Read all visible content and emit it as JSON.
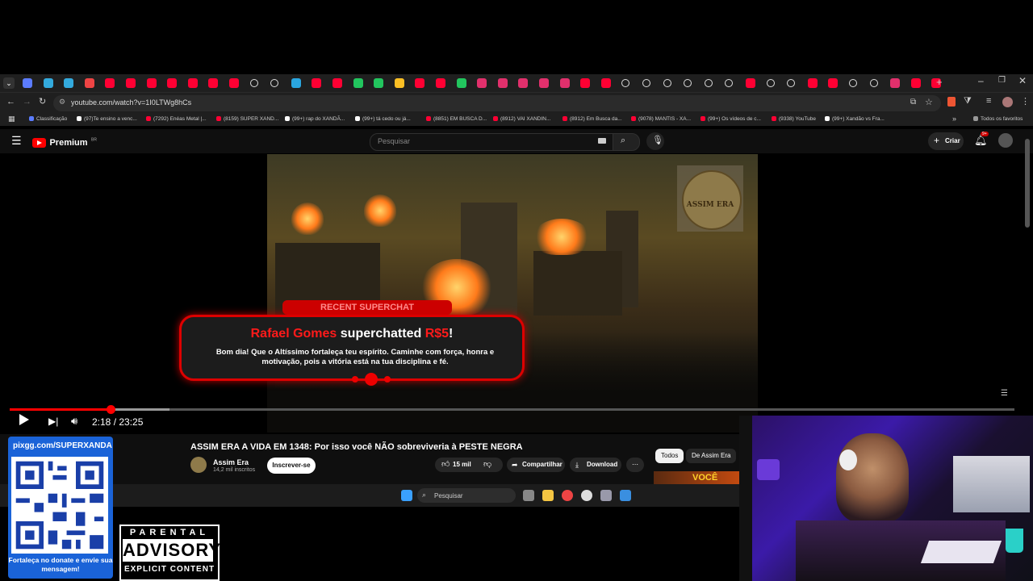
{
  "browser": {
    "url": "youtube.com/watch?v=1I0LTWg8hCs",
    "bookmarks": [
      {
        "label": "Classificação",
        "color": "#5b7cff"
      },
      {
        "label": "(97)Te ensino a venc...",
        "color": "#ffffff"
      },
      {
        "label": "(7292) Enéas Metal |...",
        "color": "#ff0033"
      },
      {
        "label": "(8159) SUPER XAND...",
        "color": "#ff0033"
      },
      {
        "label": "(99+) rap do XANDÃ...",
        "color": "#ffffff"
      },
      {
        "label": "(99+) tá cedo ou já...",
        "color": "#ffffff"
      },
      {
        "label": "(8851) EM BUSCA D...",
        "color": "#ff0033"
      },
      {
        "label": "(8912) VAI XANDIN...",
        "color": "#ff0033"
      },
      {
        "label": "(8912) Em Busca da...",
        "color": "#ff0033"
      },
      {
        "label": "(9078) MANTIS - XA...",
        "color": "#ff0033"
      },
      {
        "label": "(99+) Os vídeos de c...",
        "color": "#ff0033"
      },
      {
        "label": "(9338) YouTube",
        "color": "#ff0033"
      },
      {
        "label": "(99+) Xandão vs Fra...",
        "color": "#ffffff"
      }
    ],
    "all_bookmarks": "Todos os favoritos"
  },
  "youtube": {
    "logo_text": "Premium",
    "region": "BR",
    "search_placeholder": "Pesquisar",
    "create_label": "Criar",
    "notif_badge": "9+"
  },
  "video": {
    "watermark": "ASSIM ERA",
    "superchat_tag": "RECENT SUPERCHAT",
    "superchat_name": "Rafael Gomes",
    "superchat_verb": " superchatted ",
    "superchat_amount": "R$5",
    "superchat_bang": "!",
    "superchat_message": "Bom dia! Que o Altíssimo fortaleça teu espírito. Caminhe com força, honra e motivação, pois a vitória está na tua disciplina e fé.",
    "current_time": "2:18",
    "duration": "23:25",
    "progress": 0.1,
    "buffered": 0.159
  },
  "watch": {
    "title": "ASSIM ERA A VIDA EM 1348: Por isso você NÃO sobreviveria à PESTE NEGRA",
    "channel": "Assim Era",
    "subscribers": "14,2 mil inscritos",
    "subscribe": "Inscrever-se",
    "likes": "15 mil",
    "share": "Compartilhar",
    "download": "Download",
    "chips": [
      "Todos",
      "De Assim Era"
    ],
    "rec_thumb_text": "VOCÊ"
  },
  "taskbar": {
    "search_label": "Pesquisar"
  },
  "overlay": {
    "donate_url": "pixgg.com/SUPERXANDA",
    "donate_caption": "Fortaleça no donate e envie sua mensagem!",
    "advisory_top": "PARENTAL",
    "advisory_mid": "ADVISORY",
    "advisory_bot": "EXPLICIT CONTENT"
  }
}
